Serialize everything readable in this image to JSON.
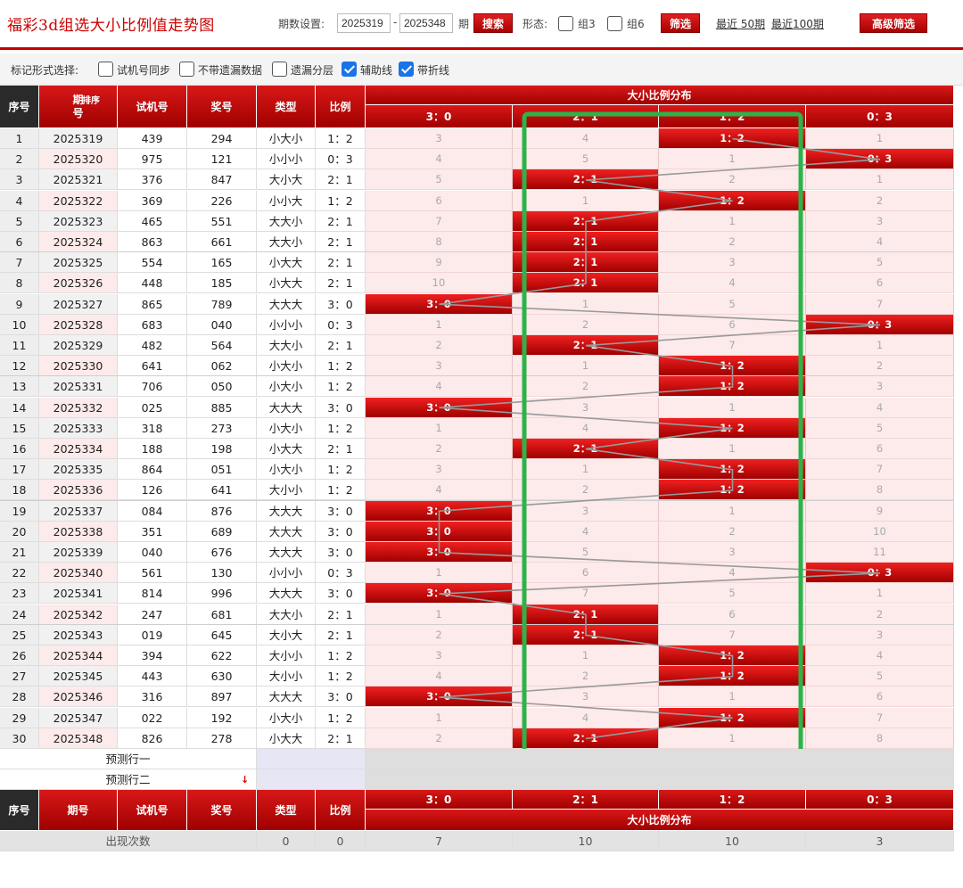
{
  "header": {
    "title": "福彩3d组选大小比例值走势图",
    "period_label": "期数设置:",
    "period_from": "2025319",
    "period_dash": "-",
    "period_to": "2025348",
    "period_unit": "期",
    "search_btn": "搜索",
    "form_label": "形态:",
    "g3": "组3",
    "g6": "组6",
    "filter_btn": "筛选",
    "recent50": "最近 50期",
    "recent100": "最近100期",
    "adv_btn": "高级筛选"
  },
  "markbar": {
    "label": "标记形式选择:",
    "options": [
      {
        "text": "试机号同步",
        "checked": false
      },
      {
        "text": "不带遗漏数据",
        "checked": false
      },
      {
        "text": "遗漏分层",
        "checked": false
      },
      {
        "text": "辅助线",
        "checked": true
      },
      {
        "text": "带折线",
        "checked": true
      }
    ]
  },
  "columns": {
    "seq": "序号",
    "issue": "期号",
    "issue_top": "期",
    "issue_bottom": "号",
    "sort": "排序",
    "test": "试机号",
    "draw": "奖号",
    "type": "类型",
    "ratio": "比例",
    "dist_title": "大小比例分布",
    "ratios": [
      "3：0",
      "2：1",
      "1：2",
      "0：3"
    ]
  },
  "rows": [
    {
      "seq": "1",
      "issue": "2025319",
      "test": "439",
      "draw": "294",
      "type": "小大小",
      "ratio": "1：2",
      "hit": 2,
      "miss": [
        "3",
        "4",
        "1：2",
        "1"
      ]
    },
    {
      "seq": "2",
      "issue": "2025320",
      "test": "975",
      "draw": "121",
      "type": "小小小",
      "ratio": "0：3",
      "hit": 3,
      "miss": [
        "4",
        "5",
        "1",
        "0：3"
      ]
    },
    {
      "seq": "3",
      "issue": "2025321",
      "test": "376",
      "draw": "847",
      "type": "大小大",
      "ratio": "2：1",
      "hit": 1,
      "miss": [
        "5",
        "2：1",
        "2",
        "1"
      ]
    },
    {
      "seq": "4",
      "issue": "2025322",
      "test": "369",
      "draw": "226",
      "type": "小小大",
      "ratio": "1：2",
      "hit": 2,
      "miss": [
        "6",
        "1",
        "1：2",
        "2"
      ]
    },
    {
      "seq": "5",
      "issue": "2025323",
      "test": "465",
      "draw": "551",
      "type": "大大小",
      "ratio": "2：1",
      "hit": 1,
      "miss": [
        "7",
        "2：1",
        "1",
        "3"
      ]
    },
    {
      "seq": "6",
      "issue": "2025324",
      "test": "863",
      "draw": "661",
      "type": "大大小",
      "ratio": "2：1",
      "hit": 1,
      "miss": [
        "8",
        "2：1",
        "2",
        "4"
      ]
    },
    {
      "seq": "7",
      "issue": "2025325",
      "test": "554",
      "draw": "165",
      "type": "小大大",
      "ratio": "2：1",
      "hit": 1,
      "miss": [
        "9",
        "2：1",
        "3",
        "5"
      ]
    },
    {
      "seq": "8",
      "issue": "2025326",
      "test": "448",
      "draw": "185",
      "type": "小大大",
      "ratio": "2：1",
      "hit": 1,
      "miss": [
        "10",
        "2：1",
        "4",
        "6"
      ]
    },
    {
      "seq": "9",
      "issue": "2025327",
      "test": "865",
      "draw": "789",
      "type": "大大大",
      "ratio": "3：0",
      "hit": 0,
      "miss": [
        "3：0",
        "1",
        "5",
        "7"
      ]
    },
    {
      "seq": "10",
      "issue": "2025328",
      "test": "683",
      "draw": "040",
      "type": "小小小",
      "ratio": "0：3",
      "hit": 3,
      "miss": [
        "1",
        "2",
        "6",
        "0：3"
      ]
    },
    {
      "seq": "11",
      "issue": "2025329",
      "test": "482",
      "draw": "564",
      "type": "大大小",
      "ratio": "2：1",
      "hit": 1,
      "miss": [
        "2",
        "2：1",
        "7",
        "1"
      ]
    },
    {
      "seq": "12",
      "issue": "2025330",
      "test": "641",
      "draw": "062",
      "type": "小大小",
      "ratio": "1：2",
      "hit": 2,
      "miss": [
        "3",
        "1",
        "1：2",
        "2"
      ]
    },
    {
      "seq": "13",
      "issue": "2025331",
      "test": "706",
      "draw": "050",
      "type": "小大小",
      "ratio": "1：2",
      "hit": 2,
      "miss": [
        "4",
        "2",
        "1：2",
        "3"
      ]
    },
    {
      "seq": "14",
      "issue": "2025332",
      "test": "025",
      "draw": "885",
      "type": "大大大",
      "ratio": "3：0",
      "hit": 0,
      "miss": [
        "3：0",
        "3",
        "1",
        "4"
      ]
    },
    {
      "seq": "15",
      "issue": "2025333",
      "test": "318",
      "draw": "273",
      "type": "小大小",
      "ratio": "1：2",
      "hit": 2,
      "miss": [
        "1",
        "4",
        "1：2",
        "5"
      ]
    },
    {
      "seq": "16",
      "issue": "2025334",
      "test": "188",
      "draw": "198",
      "type": "小大大",
      "ratio": "2：1",
      "hit": 1,
      "miss": [
        "2",
        "2：1",
        "1",
        "6"
      ]
    },
    {
      "seq": "17",
      "issue": "2025335",
      "test": "864",
      "draw": "051",
      "type": "小大小",
      "ratio": "1：2",
      "hit": 2,
      "miss": [
        "3",
        "1",
        "1：2",
        "7"
      ]
    },
    {
      "seq": "18",
      "issue": "2025336",
      "test": "126",
      "draw": "641",
      "type": "大小小",
      "ratio": "1：2",
      "hit": 2,
      "miss": [
        "4",
        "2",
        "1：2",
        "8"
      ]
    },
    {
      "seq": "19",
      "issue": "2025337",
      "test": "084",
      "draw": "876",
      "type": "大大大",
      "ratio": "3：0",
      "hit": 0,
      "miss": [
        "3：0",
        "3",
        "1",
        "9"
      ]
    },
    {
      "seq": "20",
      "issue": "2025338",
      "test": "351",
      "draw": "689",
      "type": "大大大",
      "ratio": "3：0",
      "hit": 0,
      "miss": [
        "3：0",
        "4",
        "2",
        "10"
      ]
    },
    {
      "seq": "21",
      "issue": "2025339",
      "test": "040",
      "draw": "676",
      "type": "大大大",
      "ratio": "3：0",
      "hit": 0,
      "miss": [
        "3：0",
        "5",
        "3",
        "11"
      ]
    },
    {
      "seq": "22",
      "issue": "2025340",
      "test": "561",
      "draw": "130",
      "type": "小小小",
      "ratio": "0：3",
      "hit": 3,
      "miss": [
        "1",
        "6",
        "4",
        "0：3"
      ]
    },
    {
      "seq": "23",
      "issue": "2025341",
      "test": "814",
      "draw": "996",
      "type": "大大大",
      "ratio": "3：0",
      "hit": 0,
      "miss": [
        "3：0",
        "7",
        "5",
        "1"
      ]
    },
    {
      "seq": "24",
      "issue": "2025342",
      "test": "247",
      "draw": "681",
      "type": "大大小",
      "ratio": "2：1",
      "hit": 1,
      "miss": [
        "1",
        "2：1",
        "6",
        "2"
      ]
    },
    {
      "seq": "25",
      "issue": "2025343",
      "test": "019",
      "draw": "645",
      "type": "大小大",
      "ratio": "2：1",
      "hit": 1,
      "miss": [
        "2",
        "2：1",
        "7",
        "3"
      ]
    },
    {
      "seq": "26",
      "issue": "2025344",
      "test": "394",
      "draw": "622",
      "type": "大小小",
      "ratio": "1：2",
      "hit": 2,
      "miss": [
        "3",
        "1",
        "1：2",
        "4"
      ]
    },
    {
      "seq": "27",
      "issue": "2025345",
      "test": "443",
      "draw": "630",
      "type": "大小小",
      "ratio": "1：2",
      "hit": 2,
      "miss": [
        "4",
        "2",
        "1：2",
        "5"
      ]
    },
    {
      "seq": "28",
      "issue": "2025346",
      "test": "316",
      "draw": "897",
      "type": "大大大",
      "ratio": "3：0",
      "hit": 0,
      "miss": [
        "3：0",
        "3",
        "1",
        "6"
      ]
    },
    {
      "seq": "29",
      "issue": "2025347",
      "test": "022",
      "draw": "192",
      "type": "小大小",
      "ratio": "1：2",
      "hit": 2,
      "miss": [
        "1",
        "4",
        "1：2",
        "7"
      ]
    },
    {
      "seq": "30",
      "issue": "2025348",
      "test": "826",
      "draw": "278",
      "type": "小大大",
      "ratio": "2：1",
      "hit": 1,
      "miss": [
        "2",
        "2：1",
        "1",
        "8"
      ]
    }
  ],
  "predict": [
    "预测行一",
    "预测行二"
  ],
  "stats": {
    "label": "出现次数",
    "type": "0",
    "ratio": "0",
    "dist": [
      "7",
      "10",
      "10",
      "3"
    ]
  },
  "colors": {
    "accent": "#c40000",
    "hit_top": "#f02020",
    "hit_bottom": "#a00000",
    "miss_bg": "#fdeaea",
    "highlight_box": "#2db34a"
  }
}
